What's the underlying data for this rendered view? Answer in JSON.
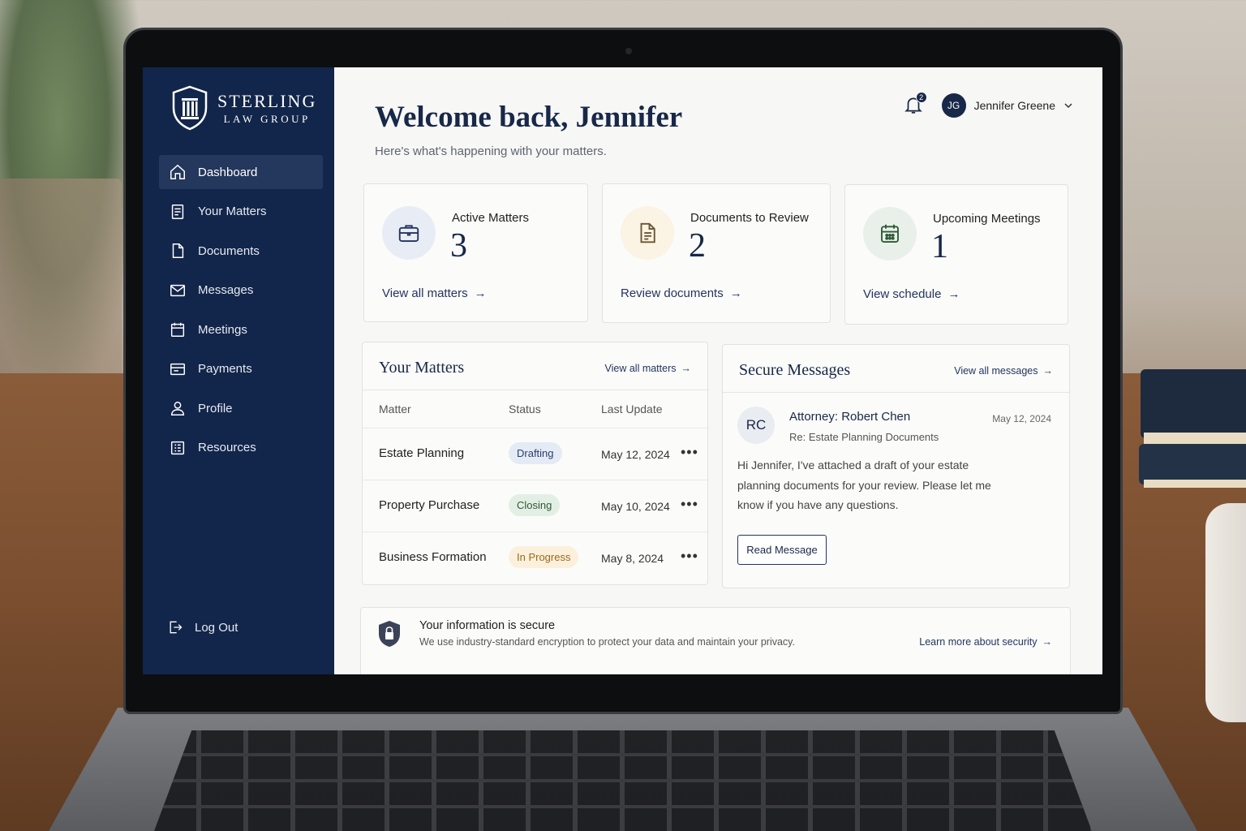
{
  "brand": {
    "name": "STERLING",
    "sub": "LAW GROUP"
  },
  "nav": [
    {
      "label": "Dashboard"
    },
    {
      "label": "Your Matters"
    },
    {
      "label": "Documents"
    },
    {
      "label": "Messages"
    },
    {
      "label": "Meetings"
    },
    {
      "label": "Payments"
    },
    {
      "label": "Profile"
    },
    {
      "label": "Resources"
    }
  ],
  "logout_label": "Log Out",
  "header": {
    "title": "Welcome back, Jennifer",
    "subtitle": "Here's what's happening with your matters.",
    "notification_count": "2",
    "user_initials": "JG",
    "user_name": "Jennifer Greene"
  },
  "stats": [
    {
      "label": "Active Matters",
      "value": "3",
      "link": "View all matters",
      "icon": "briefcase-icon",
      "color": "#e8edf5"
    },
    {
      "label": "Documents to Review",
      "value": "2",
      "link": "Review documents",
      "icon": "document-icon",
      "color": "#fbf3e3"
    },
    {
      "label": "Upcoming Meetings",
      "value": "1",
      "link": "View schedule",
      "icon": "calendar-icon",
      "color": "#e9f0ea"
    }
  ],
  "matters": {
    "title": "Your Matters",
    "link": "View all matters",
    "columns": [
      "Matter",
      "Status",
      "Last Update"
    ],
    "rows": [
      {
        "matter": "Estate Planning",
        "status": "Drafting",
        "date": "May 12, 2024",
        "status_color": "#e4ebf5",
        "status_text": "#2a3f6a"
      },
      {
        "matter": "Property Purchase",
        "status": "Closing",
        "date": "May 10, 2024",
        "status_color": "#e3efe4",
        "status_text": "#2e5a35"
      },
      {
        "matter": "Business Formation",
        "status": "In Progress",
        "date": "May 8, 2024",
        "status_color": "#fbf0dc",
        "status_text": "#9a6a1c"
      }
    ]
  },
  "messages": {
    "title": "Secure Messages",
    "link": "View all messages",
    "avatar": "RC",
    "from": "Attorney: Robert Chen",
    "subject": "Re: Estate Planning Documents",
    "date": "May 12, 2024",
    "body": "Hi Jennifer, I've attached a draft of your estate planning documents for your review. Please let me know if you have any questions.",
    "button": "Read Message"
  },
  "security": {
    "title": "Your information is secure",
    "desc": "We use industry-standard encryption to protect your data and maintain your privacy.",
    "link": "Learn more about security"
  },
  "arrow": "→",
  "more": "•••"
}
